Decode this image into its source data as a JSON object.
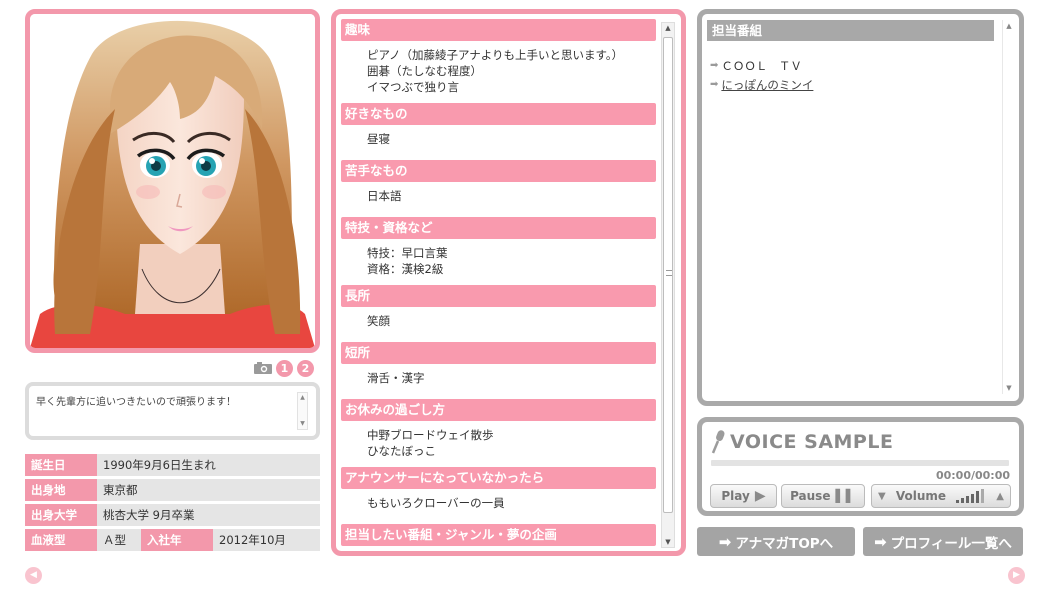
{
  "photo": {
    "page_buttons": [
      "1",
      "2"
    ],
    "icons": {
      "camera": "camera-icon"
    }
  },
  "comment": {
    "text": "早く先輩方に追いつきたいので頑張ります！"
  },
  "info": {
    "birthday_label": "誕生日",
    "birthday_value": "1990年9月6日生まれ",
    "hometown_label": "出身地",
    "hometown_value": "東京都",
    "university_label": "出身大学",
    "university_value": "桃杏大学 9月卒業",
    "blood_label": "血液型",
    "blood_value": "Ａ型",
    "join_label": "入社年",
    "join_value": "2012年10月"
  },
  "profile": {
    "sections": [
      {
        "heading": "趣味",
        "lines": [
          "ピアノ（加藤綾子アナよりも上手いと思います。）",
          "囲碁（たしなむ程度）",
          "イマつぶで独り言"
        ]
      },
      {
        "heading": "好きなもの",
        "lines": [
          "昼寝"
        ]
      },
      {
        "heading": "苦手なもの",
        "lines": [
          "日本語"
        ]
      },
      {
        "heading": "特技・資格など",
        "lines": [
          "特技：早口言葉",
          "資格：漢検2級"
        ]
      },
      {
        "heading": "長所",
        "lines": [
          "笑顔"
        ]
      },
      {
        "heading": "短所",
        "lines": [
          "滑舌・漢字"
        ]
      },
      {
        "heading": "お休みの過ごし方",
        "lines": [
          "中野ブロードウェイ散歩",
          "ひなたぼっこ"
        ]
      },
      {
        "heading": "アナウンサーになっていなかったら",
        "lines": [
          "ももいろクローバーの一員"
        ]
      },
      {
        "heading": "担当したい番組・ジャンル・夢の企画",
        "lines": []
      }
    ]
  },
  "programs": {
    "heading": "担当番組",
    "items": [
      {
        "label": "ＣＯＯＬ　ＴＶ",
        "link": false
      },
      {
        "label": "にっぽんのミンイ",
        "link": true
      }
    ]
  },
  "voice": {
    "title": "VOICE SAMPLE",
    "time": "00:00/00:00",
    "progress": 0,
    "play_label": "Play",
    "pause_label": "Pause",
    "volume_label": "Volume"
  },
  "nav": {
    "top_label": "アナマガTOPへ",
    "list_label": "プロフィール一覧へ"
  },
  "colors": {
    "pink": "#f398ab",
    "gray": "#a9a9a9"
  }
}
